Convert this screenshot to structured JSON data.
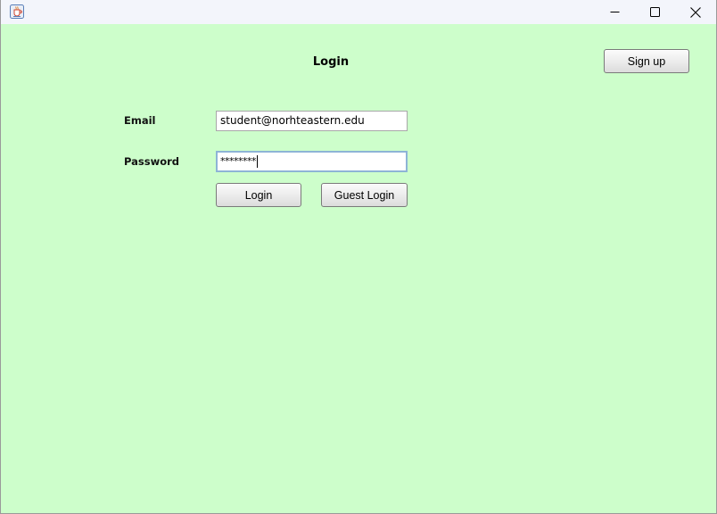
{
  "window": {
    "icon": "java-cup-icon",
    "controls": {
      "minimize": "minimize-icon",
      "maximize": "maximize-icon",
      "close": "close-icon"
    },
    "background_color": "#cdfecb"
  },
  "login_form": {
    "title": "Login",
    "email_label": "Email",
    "email_value": "student@norhteastern.edu",
    "password_label": "Password",
    "password_value": "********",
    "login_button": "Login",
    "guest_login_button": "Guest Login"
  },
  "header": {
    "signup_button": "Sign up"
  }
}
